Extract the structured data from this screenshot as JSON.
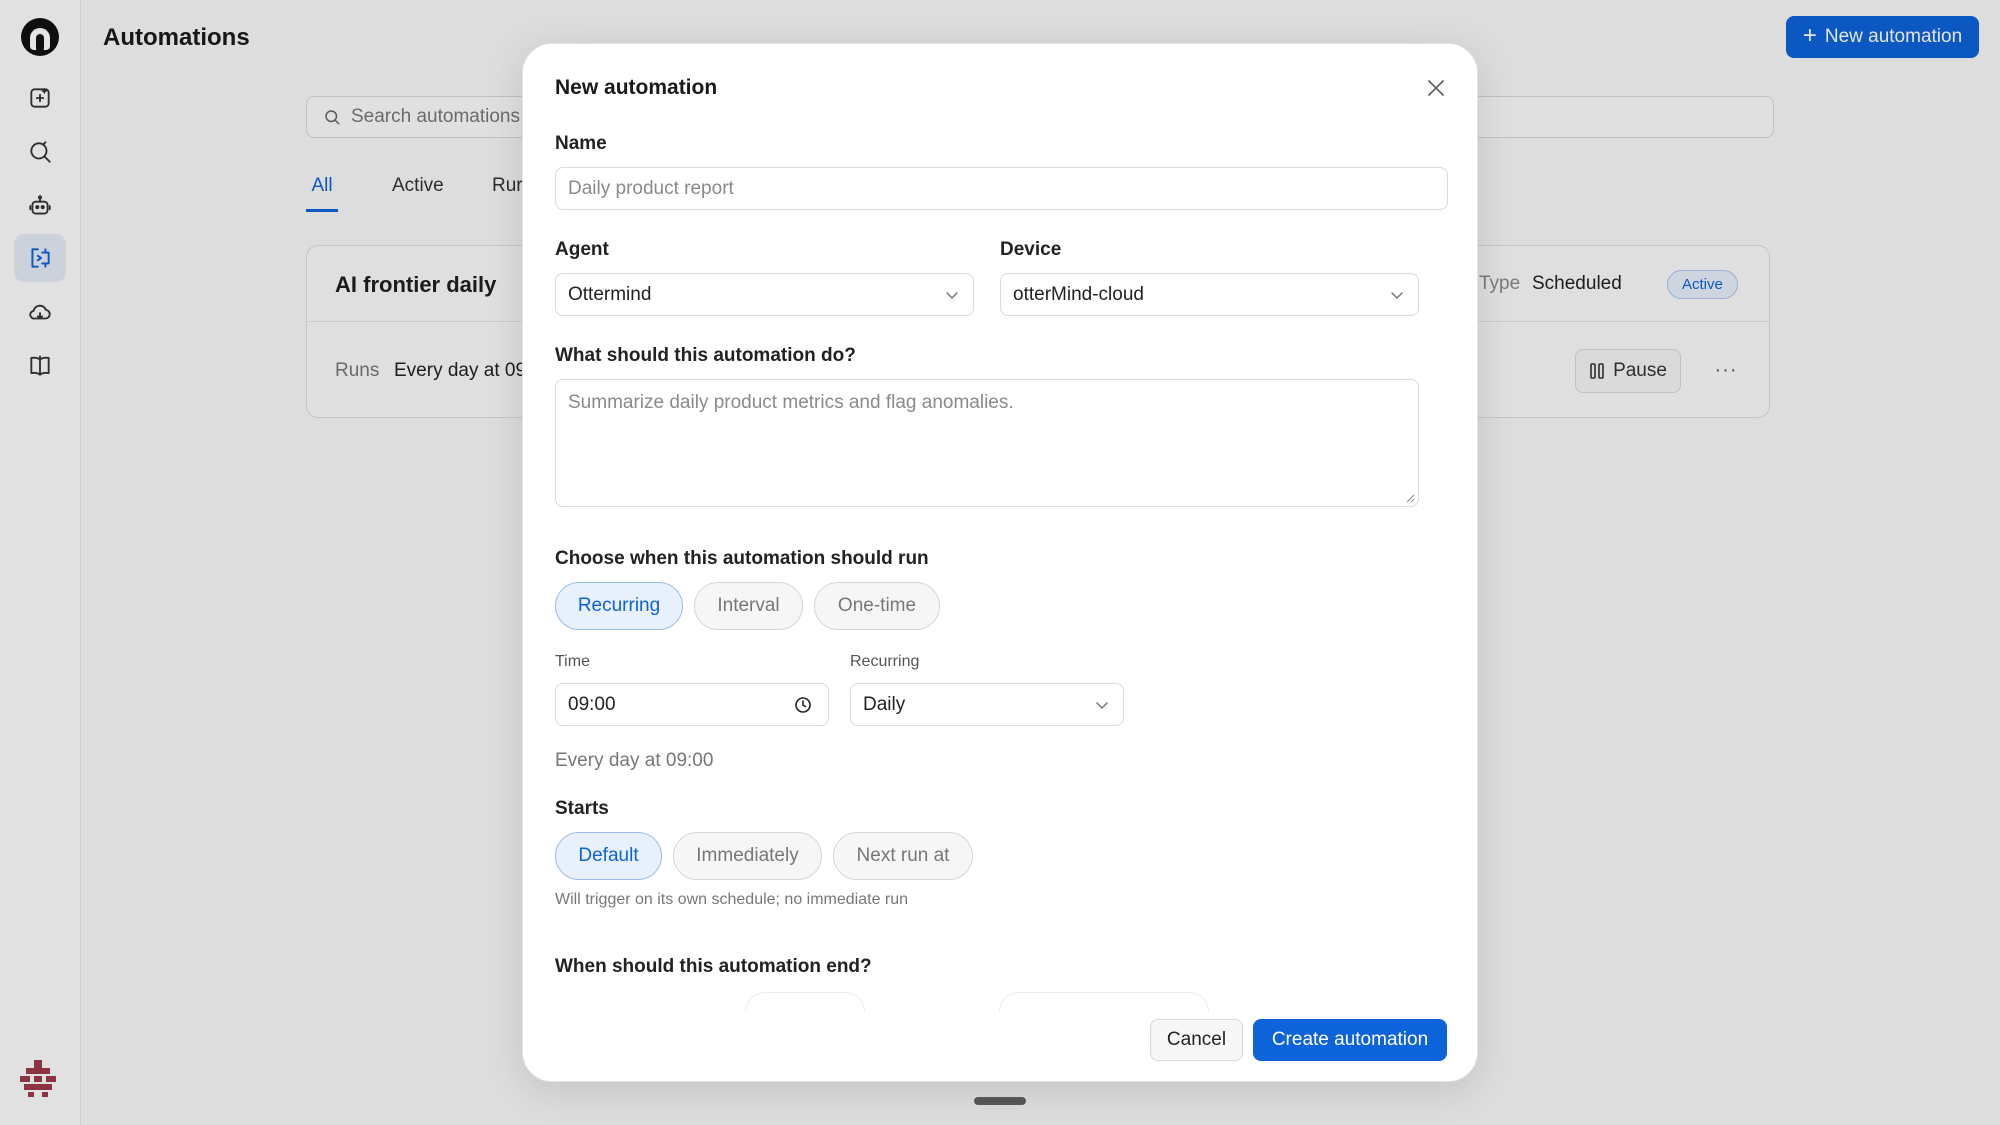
{
  "app": {
    "page_title": "Automations"
  },
  "header": {
    "new_button_label": "New automation"
  },
  "search": {
    "placeholder": "Search automations"
  },
  "tabs": [
    {
      "label": "All",
      "active": true
    },
    {
      "label": "Active",
      "active": false
    },
    {
      "label": "Rur",
      "active": false
    }
  ],
  "card": {
    "title": "AI frontier daily",
    "runs_label": "Runs",
    "runs_value": "Every day at 09",
    "type_label": "Type",
    "type_value": "Scheduled",
    "status": "Active",
    "pause_label": "Pause",
    "more_label": "···"
  },
  "sidebar": {
    "items": [
      {
        "icon": "new-chat-icon"
      },
      {
        "icon": "search-refresh-icon"
      },
      {
        "icon": "robot-icon"
      },
      {
        "icon": "automation-icon",
        "active": true
      },
      {
        "icon": "cloud-icon"
      },
      {
        "icon": "book-icon"
      }
    ]
  },
  "modal": {
    "title": "New automation",
    "name_label": "Name",
    "name_placeholder": "Daily product report",
    "agent_label": "Agent",
    "agent_value": "Ottermind",
    "device_label": "Device",
    "device_value": "otterMind-cloud",
    "task_label": "What should this automation do?",
    "task_placeholder": "Summarize daily product metrics and flag anomalies.",
    "schedule_label": "Choose when this automation should run",
    "schedule_options": [
      "Recurring",
      "Interval",
      "One-time"
    ],
    "schedule_selected": "Recurring",
    "time_label": "Time",
    "time_value": "09:00",
    "recurring_label": "Recurring",
    "recurring_value": "Daily",
    "schedule_summary": "Every day at 09:00",
    "starts_label": "Starts",
    "starts_options": [
      "Default",
      "Immediately",
      "Next run at"
    ],
    "starts_selected": "Default",
    "starts_hint": "Will trigger on its own schedule; no immediate run",
    "end_label": "When should this automation end?",
    "cancel_label": "Cancel",
    "create_label": "Create automation"
  },
  "colors": {
    "accent": "#0d63d9",
    "selected_pill_bg": "#e8f0fb",
    "sidebar_active_bg": "#e3eaf5"
  }
}
